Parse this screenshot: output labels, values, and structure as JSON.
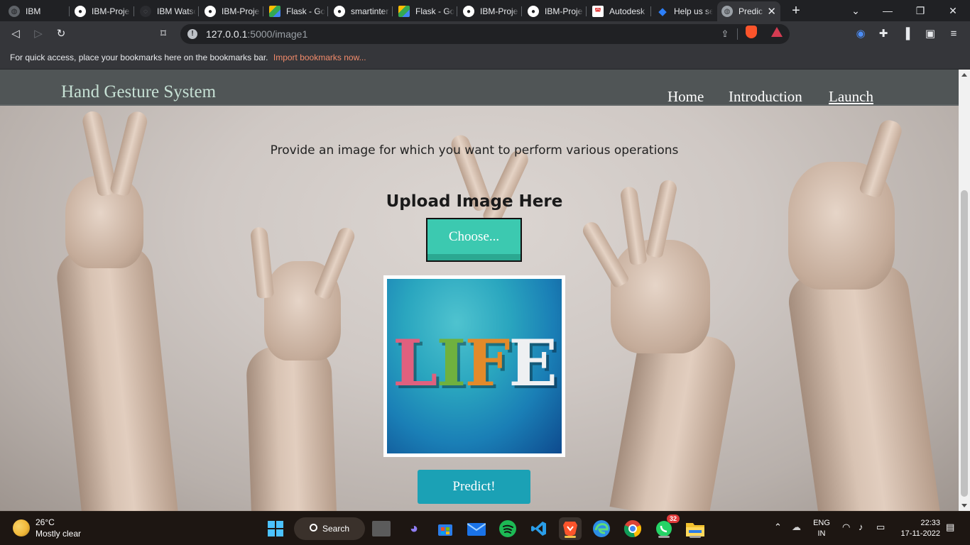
{
  "browser": {
    "tabs": [
      {
        "title": "IBM",
        "icon": "globe-icon",
        "color": "#9aa0a6"
      },
      {
        "title": "IBM-Proje",
        "icon": "github-icon",
        "color": "#ffffff"
      },
      {
        "title": "IBM Watso",
        "icon": "watson-icon",
        "color": "#6b6e73"
      },
      {
        "title": "IBM-Proje",
        "icon": "github-icon",
        "color": "#ffffff"
      },
      {
        "title": "Flask - Go",
        "icon": "google-drive-icon",
        "color": "#34a853"
      },
      {
        "title": "smartinter",
        "icon": "github-icon",
        "color": "#ffffff"
      },
      {
        "title": "Flask - Go",
        "icon": "google-drive-icon",
        "color": "#34a853"
      },
      {
        "title": "IBM-Proje",
        "icon": "github-icon",
        "color": "#ffffff"
      },
      {
        "title": "IBM-Proje",
        "icon": "github-icon",
        "color": "#ffffff"
      },
      {
        "title": "Autodesk",
        "icon": "autodesk-icon",
        "color": "#e33b3b"
      },
      {
        "title": "Help us se",
        "icon": "diamond-icon",
        "color": "#2d7ff9"
      },
      {
        "title": "Predic",
        "icon": "globe-icon",
        "color": "#9aa0a6",
        "active": true
      }
    ],
    "url_host": "127.0.0.1",
    "url_path": ":5000/image1",
    "bookmarks_message": "For quick access, place your bookmarks here on the bookmarks bar.",
    "bookmarks_link": "Import bookmarks now..."
  },
  "site": {
    "brand": "Hand Gesture System",
    "nav": [
      "Home",
      "Introduction",
      "Launch"
    ],
    "intro": "Provide an image for which you want to perform various operations",
    "upload_title": "Upload Image Here",
    "choose_label": "Choose...",
    "preview_text": "LIFE",
    "predict_label": "Predict!"
  },
  "taskbar": {
    "weather_temp": "26°C",
    "weather_desc": "Mostly clear",
    "search_label": "Search",
    "whatsapp_badge": "32",
    "lang_top": "ENG",
    "lang_bottom": "IN",
    "time": "22:33",
    "date": "17-11-2022"
  },
  "colors": {
    "nav_bg": "#505556",
    "brand_text": "#c6e0d4",
    "choose_bg": "#3cc9b0",
    "predict_bg": "#1ba1b5",
    "bookmark_link": "#f28b6b"
  }
}
